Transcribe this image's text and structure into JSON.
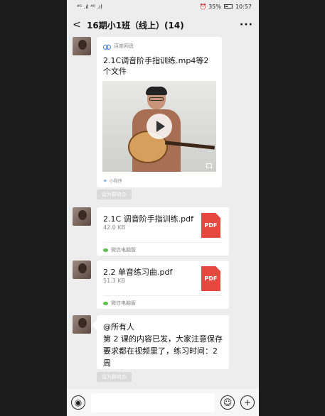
{
  "statusbar": {
    "signal": "⁴ᴳ .ıl ⁴ᴳ .ıl",
    "right_icons": "⏰ 35%",
    "time": "10:57"
  },
  "header": {
    "back": "<",
    "title": "16期小1班（线上）(14)",
    "more": "···"
  },
  "messages": {
    "mini": {
      "source": "百度网盘",
      "title": "2.1C调音阶手指训练.mp4等2个文件",
      "footer": "小程序",
      "set_group": "设为群待办"
    },
    "file1": {
      "name": "2.1C 调音阶手指训练.pdf",
      "size": "42.0 KB",
      "icon_text": "PDF",
      "label": "微信电脑版"
    },
    "file2": {
      "name": "2.2 单音练习曲.pdf",
      "size": "51.3 KB",
      "icon_text": "PDF",
      "label": "微信电脑版"
    },
    "text": {
      "body": "@所有人\n第 2 课的内容已发，大家注意保存\n要求都在视频里了，练习时间：2\n周",
      "set_group": "设为群待办"
    }
  },
  "inputbar": {
    "voice": "◉",
    "emoji": "☺",
    "plus": "+"
  }
}
